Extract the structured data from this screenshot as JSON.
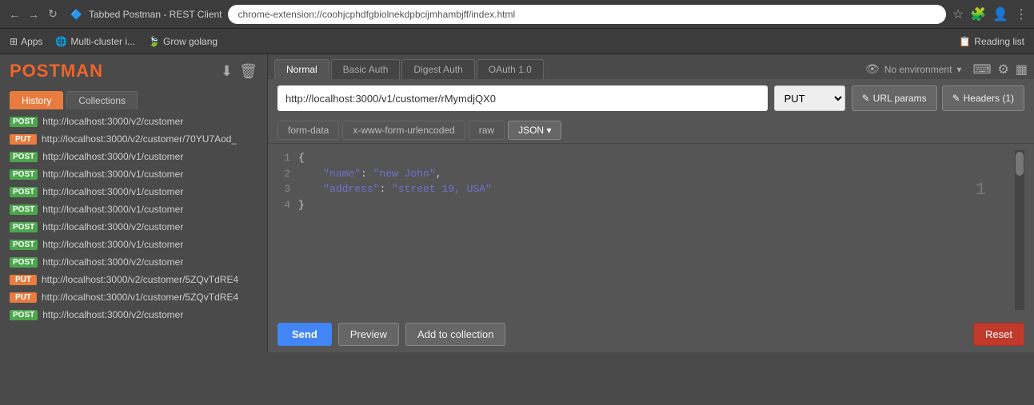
{
  "browser": {
    "tab_title": "Tabbed Postman - REST Client",
    "address": "chrome-extension://coohjcphdfgbiolnekdpbcijmhambjff/index.html",
    "bookmarks": [
      {
        "label": "Apps",
        "icon": "grid"
      },
      {
        "label": "Multi-cluster i...",
        "icon": "globe"
      },
      {
        "label": "Grow golang",
        "icon": "leaf"
      }
    ],
    "right_icons": [
      "Reading list"
    ]
  },
  "sidebar": {
    "logo": "POSTMAN",
    "tabs": [
      {
        "label": "History",
        "active": true
      },
      {
        "label": "Collections",
        "active": false
      }
    ],
    "history": [
      {
        "method": "POST",
        "url": "http://localhost:3000/v2/customer"
      },
      {
        "method": "PUT",
        "url": "http://localhost:3000/v2/customer/70YU7Aod_"
      },
      {
        "method": "POST",
        "url": "http://localhost:3000/v1/customer"
      },
      {
        "method": "POST",
        "url": "http://localhost:3000/v1/customer"
      },
      {
        "method": "POST",
        "url": "http://localhost:3000/v1/customer"
      },
      {
        "method": "POST",
        "url": "http://localhost:3000/v1/customer"
      },
      {
        "method": "POST",
        "url": "http://localhost:3000/v2/customer"
      },
      {
        "method": "POST",
        "url": "http://localhost:3000/v1/customer"
      },
      {
        "method": "POST",
        "url": "http://localhost:3000/v2/customer"
      },
      {
        "method": "PUT",
        "url": "http://localhost:3000/v2/customer/5ZQvTdRE4"
      },
      {
        "method": "PUT",
        "url": "http://localhost:3000/v1/customer/5ZQvTdRE4"
      },
      {
        "method": "POST",
        "url": "http://localhost:3000/v2/customer"
      }
    ]
  },
  "request": {
    "tabs": [
      {
        "label": "Normal",
        "active": true
      },
      {
        "label": "Basic Auth",
        "active": false
      },
      {
        "label": "Digest Auth",
        "active": false
      },
      {
        "label": "OAuth 1.0",
        "active": false
      }
    ],
    "env_label": "No environment",
    "url": "http://localhost:3000/v1/customer/rMymdjQX0",
    "method": "PUT",
    "url_params_label": "URL params",
    "headers_label": "Headers (1)",
    "body_tabs": [
      {
        "label": "form-data",
        "active": false
      },
      {
        "label": "x-www-form-urlencoded",
        "active": false
      },
      {
        "label": "raw",
        "active": false
      },
      {
        "label": "JSON",
        "active": true
      }
    ],
    "code_lines": [
      {
        "num": 1,
        "content": "{"
      },
      {
        "num": 2,
        "content": "    \"name\": \"new John\","
      },
      {
        "num": 3,
        "content": "    \"address\": \"street 19, USA\""
      },
      {
        "num": 4,
        "content": "}"
      }
    ],
    "line_badge": "1",
    "buttons": {
      "send": "Send",
      "preview": "Preview",
      "add_collection": "Add to collection",
      "reset": "Reset"
    }
  }
}
